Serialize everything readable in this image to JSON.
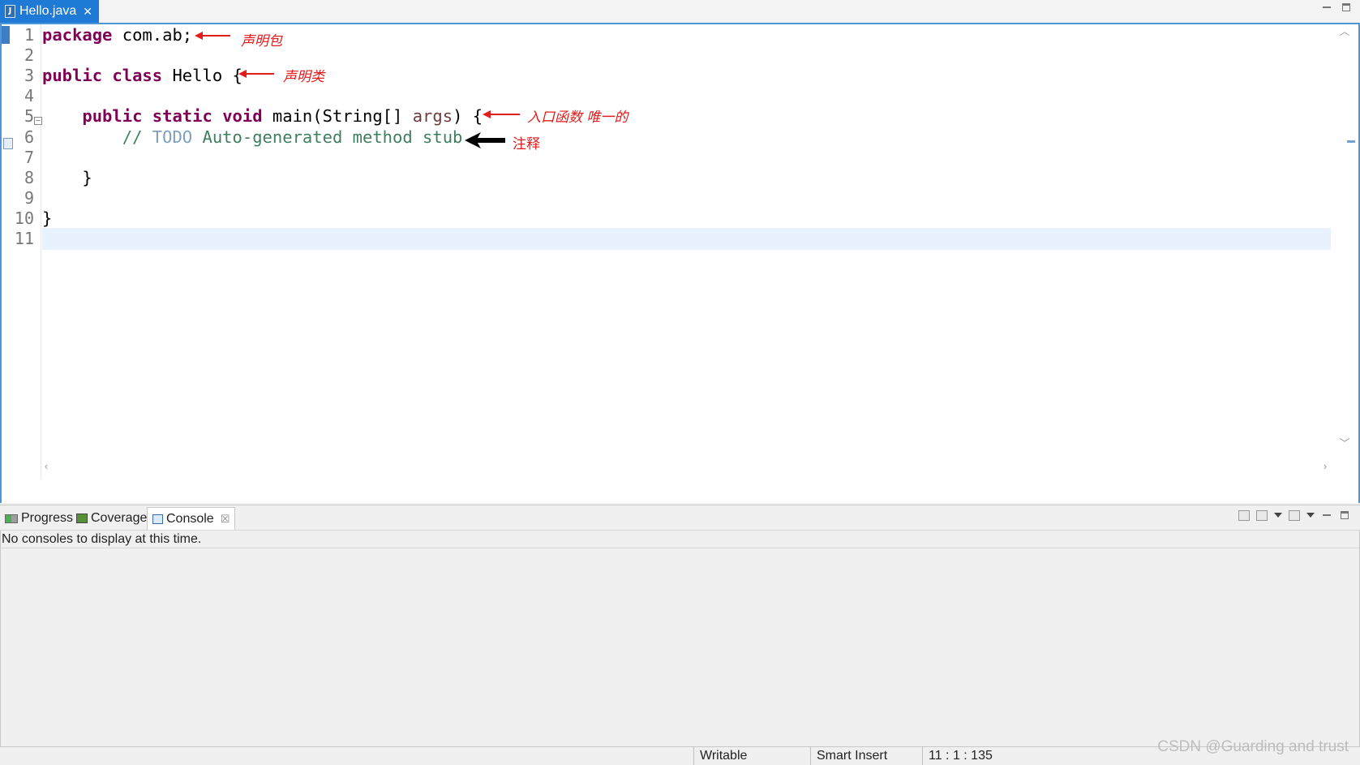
{
  "editor_tab": {
    "icon": "J",
    "title": "Hello.java",
    "close": "✕"
  },
  "code": {
    "line_numbers": [
      "1",
      "2",
      "3",
      "4",
      "5",
      "6",
      "7",
      "8",
      "9",
      "10",
      "11"
    ],
    "l1": {
      "kw": "package",
      "rest": " com.ab;"
    },
    "l3": {
      "kw1": "public",
      "kw2": "class",
      "rest": " Hello {"
    },
    "l5": {
      "kw1": "public",
      "kw2": "static",
      "kw3": "void",
      "mid": " main(String[] ",
      "param": "args",
      "end": ") {"
    },
    "l6": {
      "c1": "// ",
      "todo": "TODO",
      "c2": " Auto-generated method stub"
    },
    "l8": "}",
    "l10": "}"
  },
  "annotations": {
    "package": "声明包",
    "class": "声明类",
    "main": "入口函数 唯一的",
    "comment": "注释"
  },
  "colors": {
    "accent": "#1f7ad6",
    "keyword": "#7f0055",
    "comment": "#3f7f5f",
    "todo": "#7f9fbf",
    "annotation": "#e21b1b",
    "current_line": "#e8f2fe"
  },
  "panel": {
    "tabs": {
      "progress": "Progress",
      "coverage": "Coverage",
      "console": "Console"
    },
    "console_close": "☒",
    "message": "No consoles to display at this time."
  },
  "status": {
    "writable": "Writable",
    "insert_mode": "Smart Insert",
    "position": "11 : 1 : 135"
  },
  "watermark": "CSDN @Guarding and trust"
}
